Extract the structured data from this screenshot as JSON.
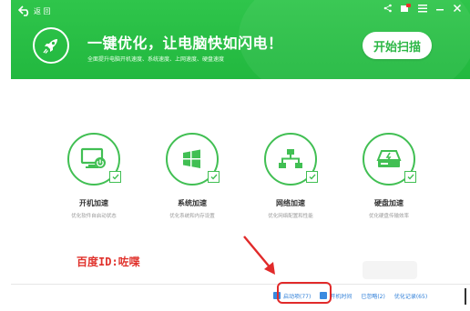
{
  "header": {
    "back_label": "返 回",
    "headline": "一键优化，让电脑快如闪电！",
    "subline": "全面提升电脑开机速度、系统速度、上网速度、硬盘速度",
    "scan_button": "开始扫描",
    "window_controls": [
      "share-icon",
      "skin-icon",
      "menu-icon",
      "minimize-icon",
      "close-icon"
    ]
  },
  "features": [
    {
      "icon": "monitor-power-icon",
      "title": "开机加速",
      "desc": "优化软件自启动状态"
    },
    {
      "icon": "windows-icon",
      "title": "系统加速",
      "desc": "优化系统和内存设置"
    },
    {
      "icon": "network-icon",
      "title": "网络加速",
      "desc": "优化网络配置和性能"
    },
    {
      "icon": "harddisk-icon",
      "title": "硬盘加速",
      "desc": "优化硬盘传输效率"
    }
  ],
  "watermark": "百度ID:咗喋",
  "footer": {
    "startup_items": "启动项(77)",
    "boot_time": "开机时间",
    "ignored": "已忽略(2)",
    "records": "优化记录(65)"
  },
  "colors": {
    "brand_green": "#22b83f",
    "link_blue": "#2f7fd8",
    "annotation_red": "#e12a2a"
  }
}
